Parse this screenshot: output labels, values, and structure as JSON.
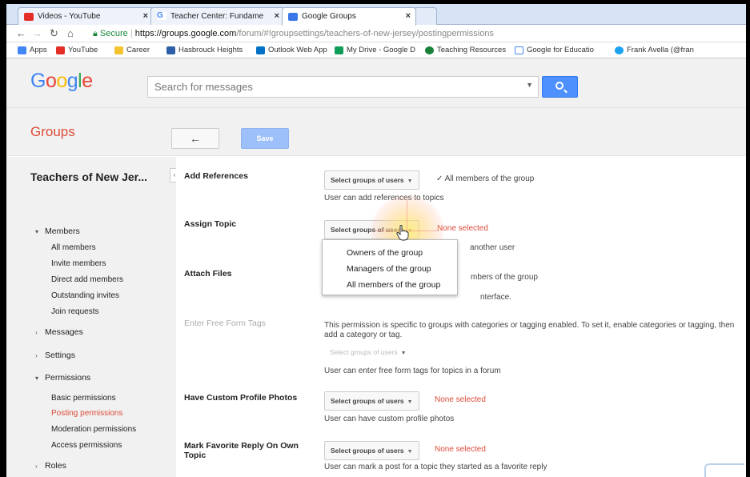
{
  "browser": {
    "tabs": [
      {
        "label": "Videos - YouTube",
        "icon": "youtube-icon",
        "color": "#e52d27"
      },
      {
        "label": "Teacher Center: Fundame",
        "icon": "google-icon",
        "color": "#4285f4"
      },
      {
        "label": "Google Groups",
        "icon": "groups-icon",
        "color": "#3b78e7"
      }
    ],
    "url_secure": "Secure",
    "url_host": "https://groups.google.com",
    "url_path": "/forum/#!groupsettings/teachers-of-new-jersey/postingpermissions",
    "bookmarks": [
      "Apps",
      "YouTube",
      "Career",
      "Hasbrouck Heights",
      "Outlook Web App",
      "My Drive - Google D",
      "Teaching Resources",
      "Google for Educatio",
      "Frank Avella (@fran"
    ]
  },
  "header": {
    "logo": "Google",
    "search_placeholder": "Search for messages"
  },
  "groupsbar": {
    "title": "Groups",
    "back_label": "←",
    "save_label": "Save"
  },
  "sidebar": {
    "group_name": "Teachers of New Jer...",
    "collapse": "‹",
    "members": "Members",
    "members_items": [
      "All members",
      "Invite members",
      "Direct add members",
      "Outstanding invites",
      "Join requests"
    ],
    "messages": "Messages",
    "settings": "Settings",
    "permissions": "Permissions",
    "permissions_items": [
      "Basic permissions",
      "Posting permissions",
      "Moderation permissions",
      "Access permissions"
    ],
    "roles": "Roles"
  },
  "settings": {
    "select_label": "Select groups of users",
    "add_references": {
      "label": "Add References",
      "state": "All members of the group",
      "desc": "User can add references to topics"
    },
    "assign_topic": {
      "label": "Assign Topic",
      "state": "None selected",
      "desc_tail": "another user"
    },
    "attach_files": {
      "label": "Attach Files",
      "state_tail": "mbers of the group",
      "desc_tail": "nterface."
    },
    "free_form_tags": {
      "label": "Enter Free Form Tags",
      "note": "This permission is specific to groups with categories or tagging enabled. To set it, enable categories or tagging, then add a category or tag.",
      "desc": "User can enter free form tags for topics in a forum"
    },
    "custom_photos": {
      "label": "Have Custom Profile Photos",
      "state": "None selected",
      "desc": "User can have custom profile photos"
    },
    "favorite_reply": {
      "label": "Mark Favorite Reply On Own Topic",
      "state": "None selected",
      "desc": "User can mark a post for a topic they started as a favorite reply"
    }
  },
  "menu": {
    "items": [
      "Owners of the group",
      "Managers of the group",
      "All members of the group"
    ]
  }
}
